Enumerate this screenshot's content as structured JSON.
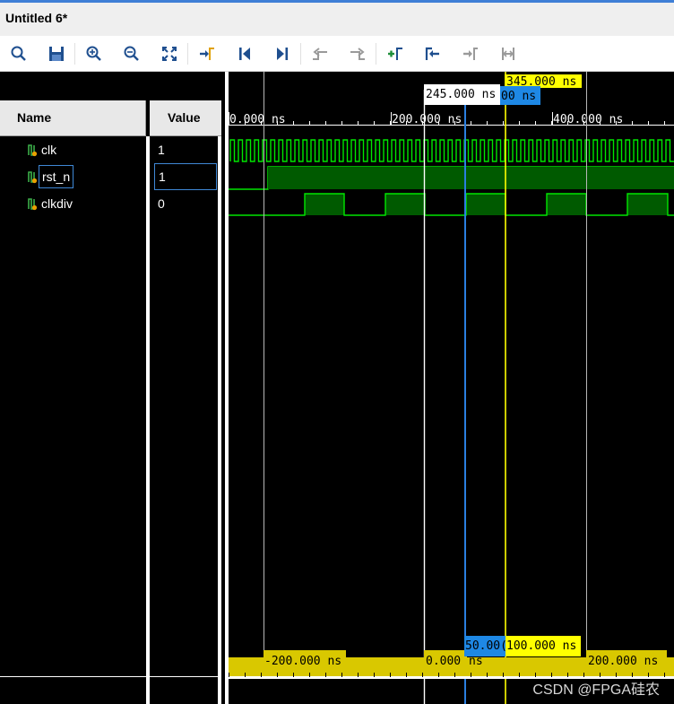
{
  "window": {
    "title": "Untitled 6*"
  },
  "toolbar": {
    "buttons": [
      {
        "icon": "search-icon"
      },
      {
        "icon": "save-icon"
      },
      {
        "icon": "zoom-in-icon"
      },
      {
        "icon": "zoom-out-icon"
      },
      {
        "icon": "zoom-fit-icon"
      },
      {
        "icon": "go-to-cursor-icon"
      },
      {
        "icon": "go-to-time-zero-icon"
      },
      {
        "icon": "go-to-last-time-icon"
      },
      {
        "icon": "previous-transition-icon"
      },
      {
        "icon": "next-transition-icon"
      },
      {
        "icon": "add-marker-icon"
      },
      {
        "icon": "previous-marker-icon"
      },
      {
        "icon": "next-marker-icon"
      },
      {
        "icon": "swap-cursors-icon"
      }
    ]
  },
  "columns": {
    "name": "Name",
    "value": "Value"
  },
  "signals": [
    {
      "name": "clk",
      "value": "1"
    },
    {
      "name": "rst_n",
      "value": "1"
    },
    {
      "name": "clkdiv",
      "value": "0"
    }
  ],
  "ruler": {
    "ticks": [
      "0.000 ns",
      "200.000 ns",
      "400.000 ns"
    ]
  },
  "markers": {
    "cursor_white": "245.000 ns",
    "cursor_blue_partial": "00 ns",
    "cursor_yellow": "345.000 ns"
  },
  "bottom_ruler": {
    "neg": "-200.000 ns",
    "zero": "0.000",
    "zero_unit": "ns",
    "blue_delta": "50.00(",
    "yellow_delta": "100.000 ns",
    "pos": "200.000 ns"
  },
  "colors": {
    "waveform_green": "#00e600",
    "bus_fill": "#005a00",
    "cursor_yellow": "#ffff00",
    "cursor_blue": "#2a7fe0",
    "marker_label_blue": "#1e88e5",
    "bottom_band": "#d9c800"
  },
  "watermark": "CSDN @FPGA硅农"
}
